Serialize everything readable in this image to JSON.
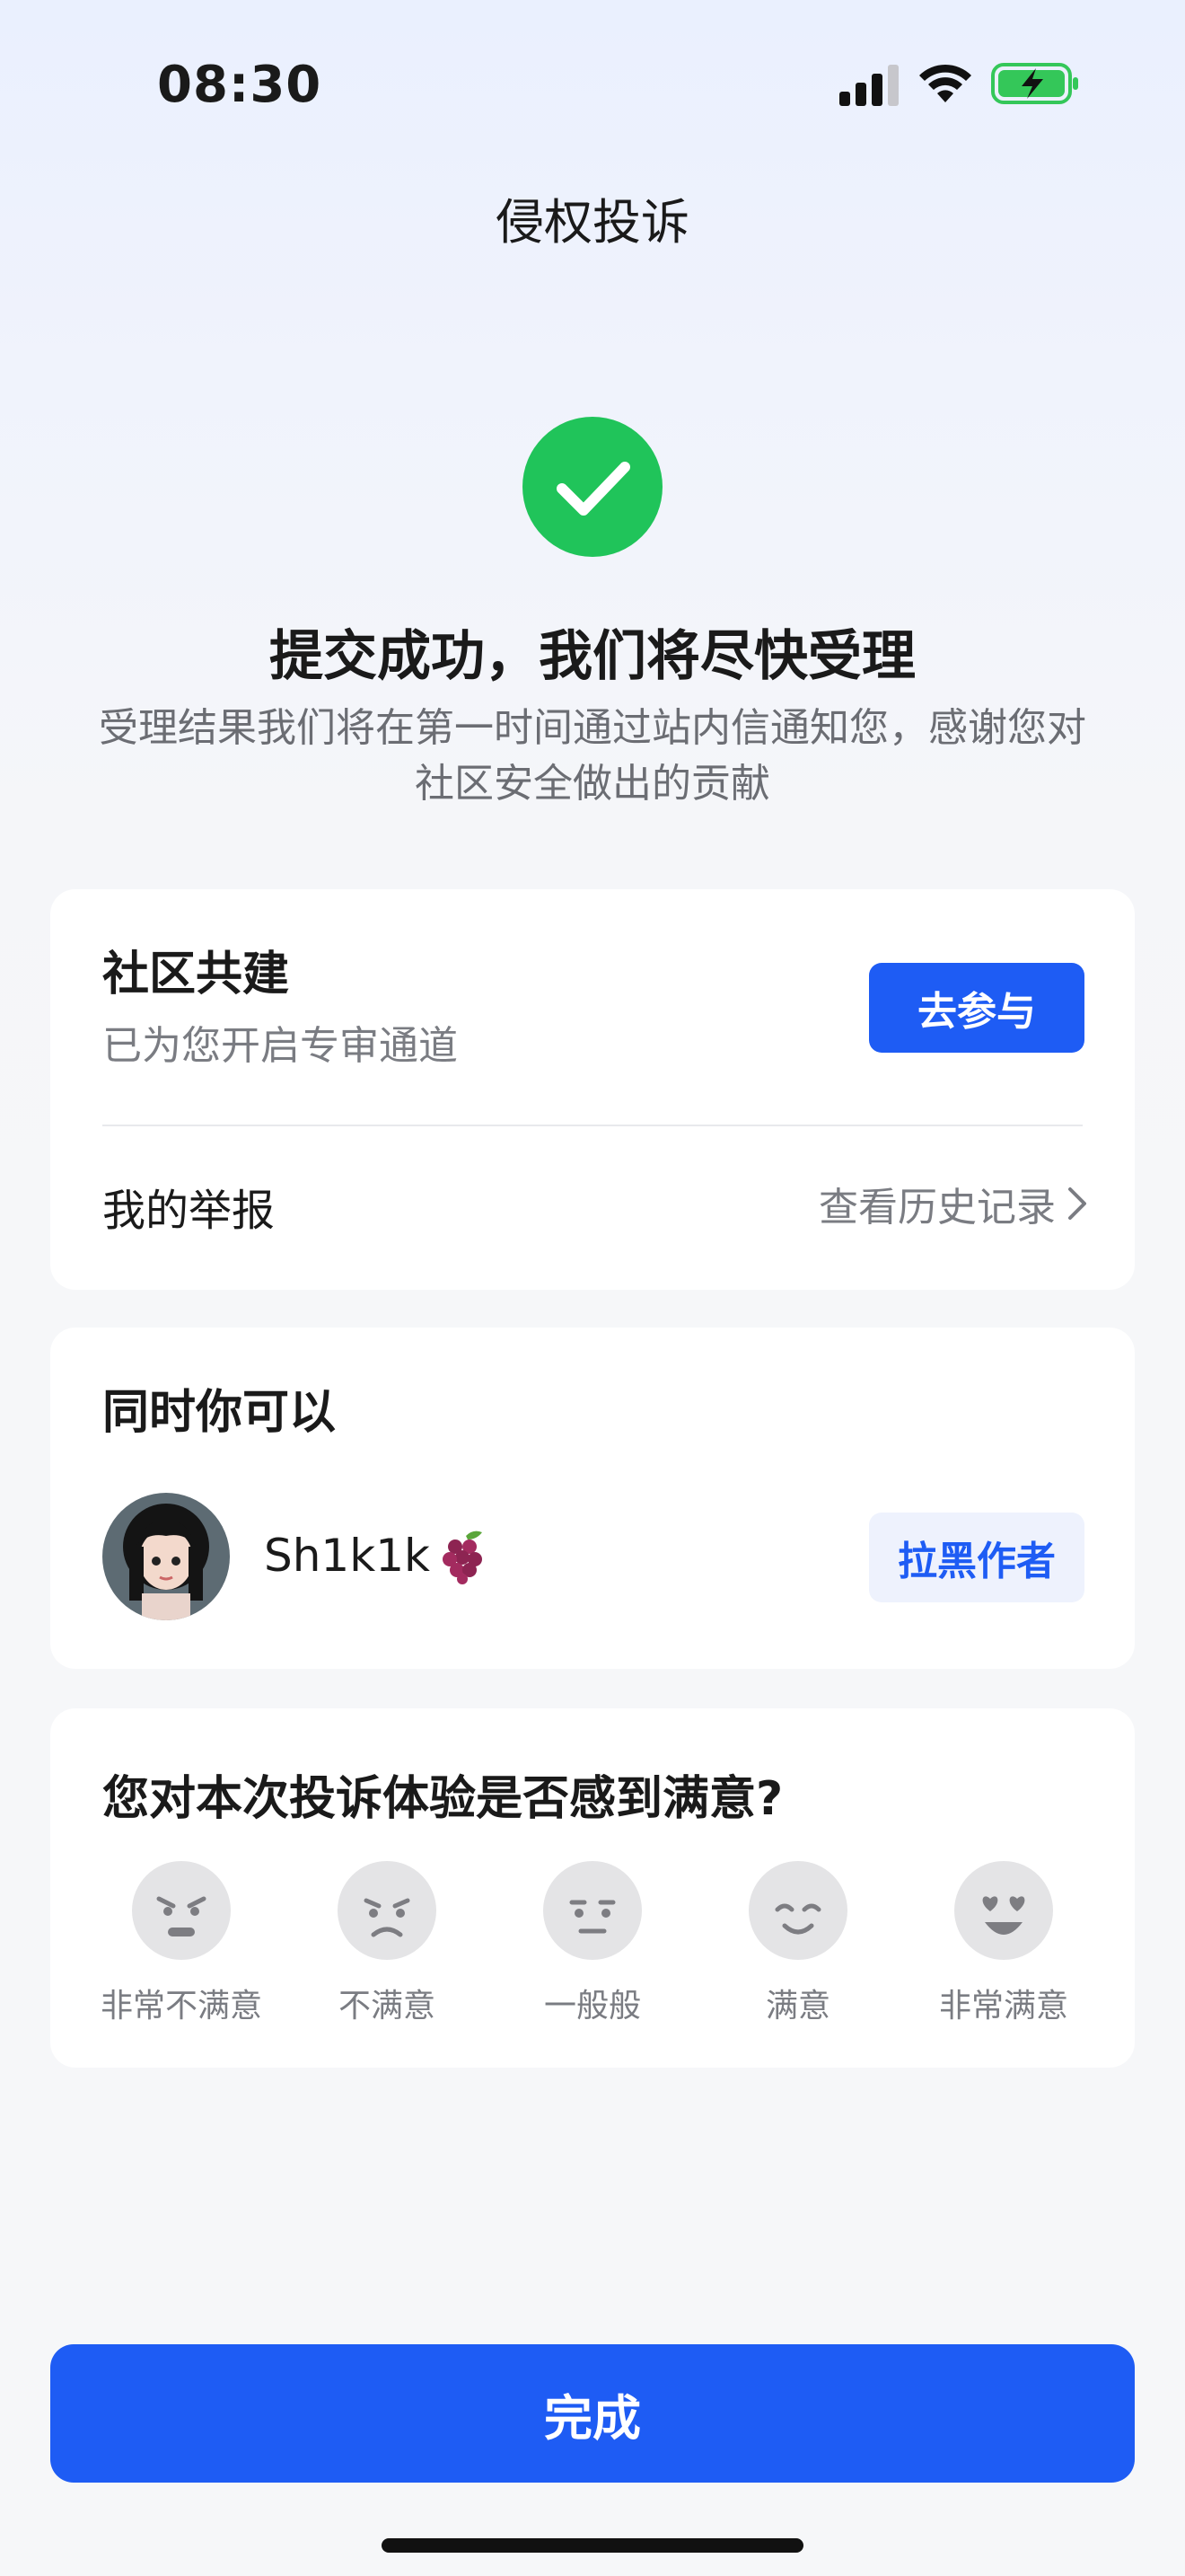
{
  "status_bar": {
    "time": "08:30",
    "battery_color": "#34c759"
  },
  "nav": {
    "title": "侵权投诉"
  },
  "result": {
    "icon": "check-circle-icon",
    "icon_color": "#20c45a",
    "title": "提交成功，我们将尽快受理",
    "description": "受理结果我们将在第一时间通过站内信通知您，感谢您对社区安全做出的贡献"
  },
  "community": {
    "title": "社区共建",
    "subtitle": "已为您开启专审通道",
    "participate_label": "去参与",
    "my_reports_label": "我的举报",
    "history_label": "查看历史记录"
  },
  "also": {
    "title": "同时你可以",
    "username": "Sh1k1k",
    "username_emoji": "grape-icon",
    "block_label": "拉黑作者"
  },
  "satisfaction": {
    "title": "您对本次投诉体验是否感到满意?",
    "options": [
      {
        "label": "非常不满意",
        "icon": "very-dissatisfied-face-icon"
      },
      {
        "label": "不满意",
        "icon": "dissatisfied-face-icon"
      },
      {
        "label": "一般般",
        "icon": "neutral-face-icon"
      },
      {
        "label": "满意",
        "icon": "satisfied-face-icon"
      },
      {
        "label": "非常满意",
        "icon": "very-satisfied-face-icon"
      }
    ]
  },
  "footer": {
    "done_label": "完成"
  },
  "colors": {
    "primary": "#1e5cf4",
    "primary_light": "#eef2fd",
    "success": "#20c45a"
  }
}
